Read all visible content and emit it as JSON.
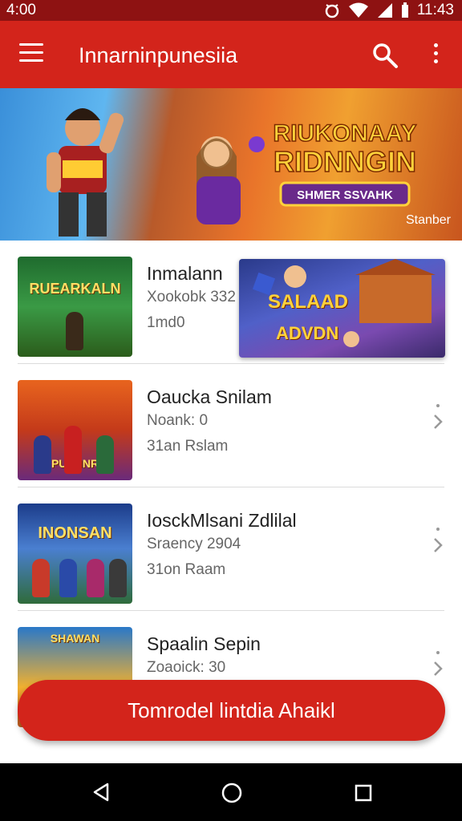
{
  "status_bar": {
    "time": "4:00",
    "clock_right": "11:43",
    "icons": [
      "alarm-icon",
      "wifi-icon",
      "signal-icon",
      "battery-icon"
    ]
  },
  "app_bar": {
    "title": "Innarninpunesiia",
    "menu_icon": "hamburger-icon",
    "search_icon": "search-icon",
    "more_icon": "more-vert-icon"
  },
  "banner": {
    "logo_line1": "RIUKONAAY",
    "logo_line2": "RIDNNGIN",
    "logo_badge": "SHMER SSVAHK",
    "corner_text": "Stanber"
  },
  "games": [
    {
      "thumb_label": "RUEARKALN",
      "title": "Inmalann",
      "subtitle": "Xookobk 332",
      "meta": "1md0"
    },
    {
      "thumb_label": "PUSHNR",
      "title": "Oaucka Snilam",
      "subtitle": "Noank: 0",
      "meta": "31an Rslam"
    },
    {
      "thumb_label": "INONSAN",
      "title": "IosckMlsani Zdlilal",
      "subtitle": "Sraency 2904",
      "meta": "31on Raam"
    },
    {
      "thumb_label": "SHAWAN",
      "title": "Spaalin Sepin",
      "subtitle": "Zoaoick: 30",
      "meta": ""
    }
  ],
  "popup_ad": {
    "line1": "SALAAD",
    "line2": "ADVDN"
  },
  "fab_label": "Tomrodel lintdia Ahaikl",
  "colors": {
    "primary": "#d3241b",
    "status_bar": "#8e1212",
    "nav_bar": "#000000"
  }
}
